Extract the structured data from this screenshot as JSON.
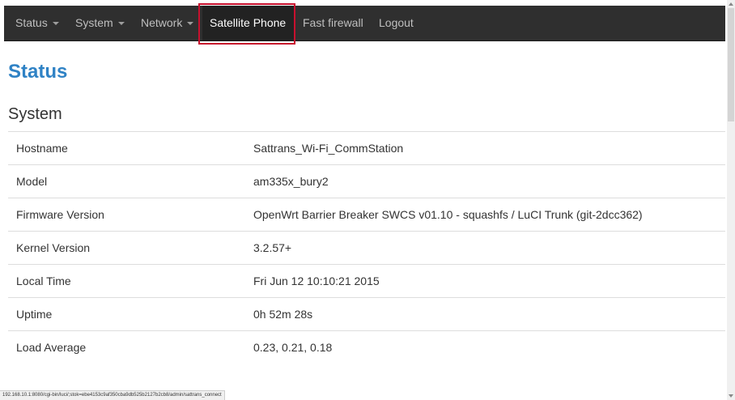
{
  "navbar": {
    "items": [
      {
        "label": "Status"
      },
      {
        "label": "System"
      },
      {
        "label": "Network"
      },
      {
        "label": "Satellite Phone"
      },
      {
        "label": "Fast firewall"
      },
      {
        "label": "Logout"
      }
    ]
  },
  "page": {
    "title": "Status",
    "section": "System"
  },
  "system": {
    "rows": [
      {
        "key": "Hostname",
        "value": "Sattrans_Wi-Fi_CommStation"
      },
      {
        "key": "Model",
        "value": "am335x_bury2"
      },
      {
        "key": "Firmware Version",
        "value": "OpenWrt Barrier Breaker SWCS v01.10 - squashfs / LuCI Trunk (git-2dcc362)"
      },
      {
        "key": "Kernel Version",
        "value": "3.2.57+"
      },
      {
        "key": "Local Time",
        "value": "Fri Jun 12 10:10:21 2015"
      },
      {
        "key": "Uptime",
        "value": "0h 52m 28s"
      },
      {
        "key": "Load Average",
        "value": "0.23, 0.21, 0.18"
      }
    ]
  },
  "statusbar": {
    "url": "192.168.10.1:8080/cgi-bin/luci/;stok=ebe4153c9af350cba9db525b2127b2cb8/admin/sattrans_connect"
  },
  "colors": {
    "navbar_bg": "#2f2f2f",
    "title_blue": "#2f82c5",
    "highlight_red": "#c8102e"
  }
}
